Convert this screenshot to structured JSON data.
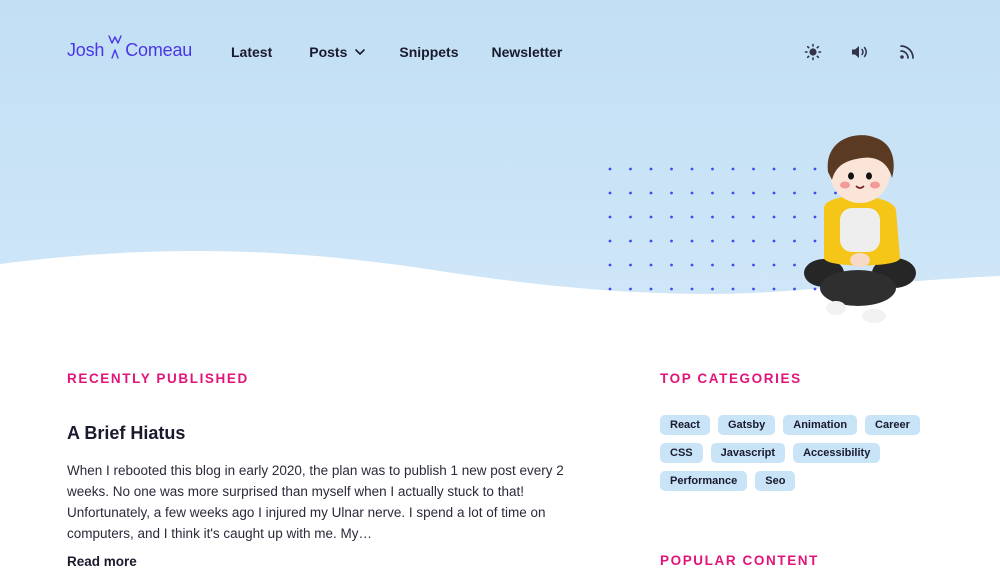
{
  "header": {
    "logo": {
      "first": "Josh",
      "second": "Comeau"
    },
    "nav": [
      {
        "label": "Latest"
      },
      {
        "label": "Posts",
        "has_dropdown": true,
        "icon": "chevron-down-icon"
      },
      {
        "label": "Snippets"
      },
      {
        "label": "Newsletter"
      }
    ],
    "actions": [
      {
        "icon": "sun-icon"
      },
      {
        "icon": "speaker-icon"
      },
      {
        "icon": "rss-icon"
      }
    ]
  },
  "hero": {
    "background_color": "#c7e3f6",
    "dot_color": "#3b4ef0"
  },
  "recent": {
    "heading": "RECENTLY PUBLISHED",
    "post": {
      "title": "A Brief Hiatus",
      "excerpt": "When I rebooted this blog in early 2020, the plan was to publish 1 new post every 2 weeks. No one was more surprised than myself when I actually stuck to that! Unfortunately, a few weeks ago I injured my Ulnar nerve. I spend a lot of time on computers, and I think it's caught up with me. My…",
      "read_more": "Read more"
    }
  },
  "categories": {
    "heading": "TOP CATEGORIES",
    "rows": [
      [
        "React",
        "Gatsby",
        "Animation",
        "Career"
      ],
      [
        "CSS",
        "Javascript",
        "Accessibility"
      ],
      [
        "Performance",
        "Seo"
      ]
    ]
  },
  "popular": {
    "heading": "POPULAR CONTENT"
  },
  "colors": {
    "accent": "#e2147a",
    "brand": "#4a36e8",
    "tag_bg": "#c9e4f7"
  }
}
